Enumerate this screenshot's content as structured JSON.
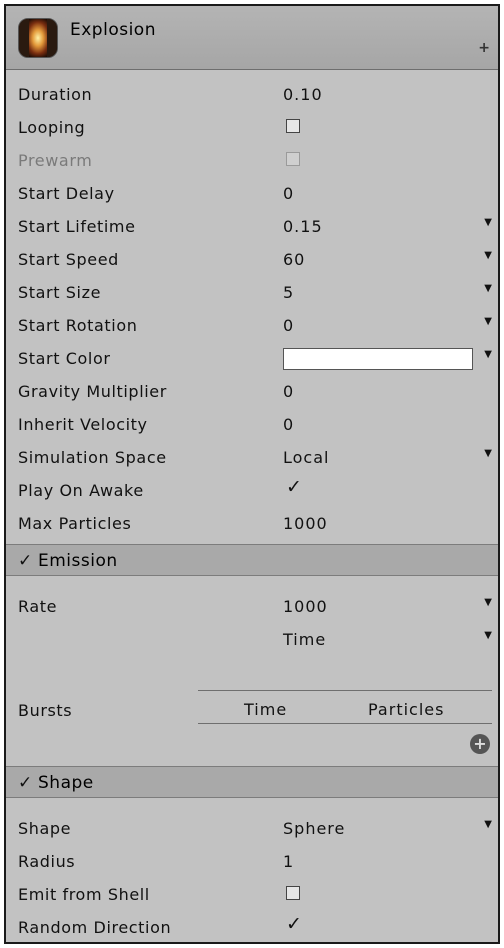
{
  "header": {
    "title": "Explosion",
    "add_symbol": "+"
  },
  "main_module": {
    "duration": {
      "label": "Duration",
      "value": "0.10"
    },
    "looping": {
      "label": "Looping",
      "checked": false
    },
    "prewarm": {
      "label": "Prewarm",
      "checked": false,
      "disabled": true
    },
    "start_delay": {
      "label": "Start Delay",
      "value": "0"
    },
    "start_lifetime": {
      "label": "Start Lifetime",
      "value": "0.15"
    },
    "start_speed": {
      "label": "Start Speed",
      "value": "60"
    },
    "start_size": {
      "label": "Start Size",
      "value": "5"
    },
    "start_rotation": {
      "label": "Start Rotation",
      "value": "0"
    },
    "start_color": {
      "label": "Start Color",
      "color": "#ffffff"
    },
    "gravity_multiplier": {
      "label": "Gravity Multiplier",
      "value": "0"
    },
    "inherit_velocity": {
      "label": "Inherit Velocity",
      "value": "0"
    },
    "simulation_space": {
      "label": "Simulation Space",
      "value": "Local"
    },
    "play_on_awake": {
      "label": "Play On Awake",
      "checked": true
    },
    "max_particles": {
      "label": "Max Particles",
      "value": "1000"
    }
  },
  "emission": {
    "title": "Emission",
    "enabled": true,
    "rate": {
      "label": "Rate",
      "value": "1000",
      "mode": "Time"
    },
    "bursts": {
      "label": "Bursts",
      "col_time": "Time",
      "col_particles": "Particles"
    }
  },
  "shape": {
    "title": "Shape",
    "enabled": true,
    "shape": {
      "label": "Shape",
      "value": "Sphere"
    },
    "radius": {
      "label": "Radius",
      "value": "1"
    },
    "emit_from_shell": {
      "label": "Emit from Shell",
      "checked": false
    },
    "random_direction": {
      "label": "Random Direction",
      "checked": true
    }
  },
  "symbols": {
    "check": "✓",
    "arrow": "▼",
    "add": "+"
  },
  "colors": {
    "panel_bg": "#c2c2c2",
    "header_bg": "#a9a9a9",
    "start_color": "#ffffff"
  }
}
